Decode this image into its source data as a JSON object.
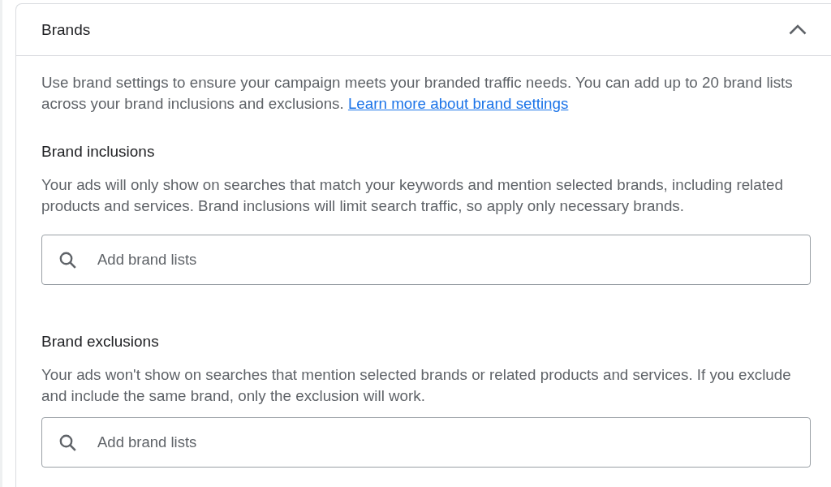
{
  "panel": {
    "title": "Brands",
    "expanded": true
  },
  "intro": {
    "text": "Use brand settings to ensure your campaign meets your branded traffic needs. You can add up to 20 brand lists across your brand inclusions and exclusions.",
    "link": "Learn more about brand settings"
  },
  "sections": [
    {
      "heading": "Brand inclusions",
      "description": "Your ads will only show on searches that match your keywords and mention selected brands, including related products and services. Brand inclusions will limit search traffic, so apply only necessary brands.",
      "search": {
        "placeholder": "Add brand lists"
      }
    },
    {
      "heading": "Brand exclusions",
      "description": "Your ads won't show on searches that mention selected brands or related products and services. If you exclude and include the same brand, only the exclusion will work.",
      "search": {
        "placeholder": "Add brand lists"
      }
    }
  ]
}
